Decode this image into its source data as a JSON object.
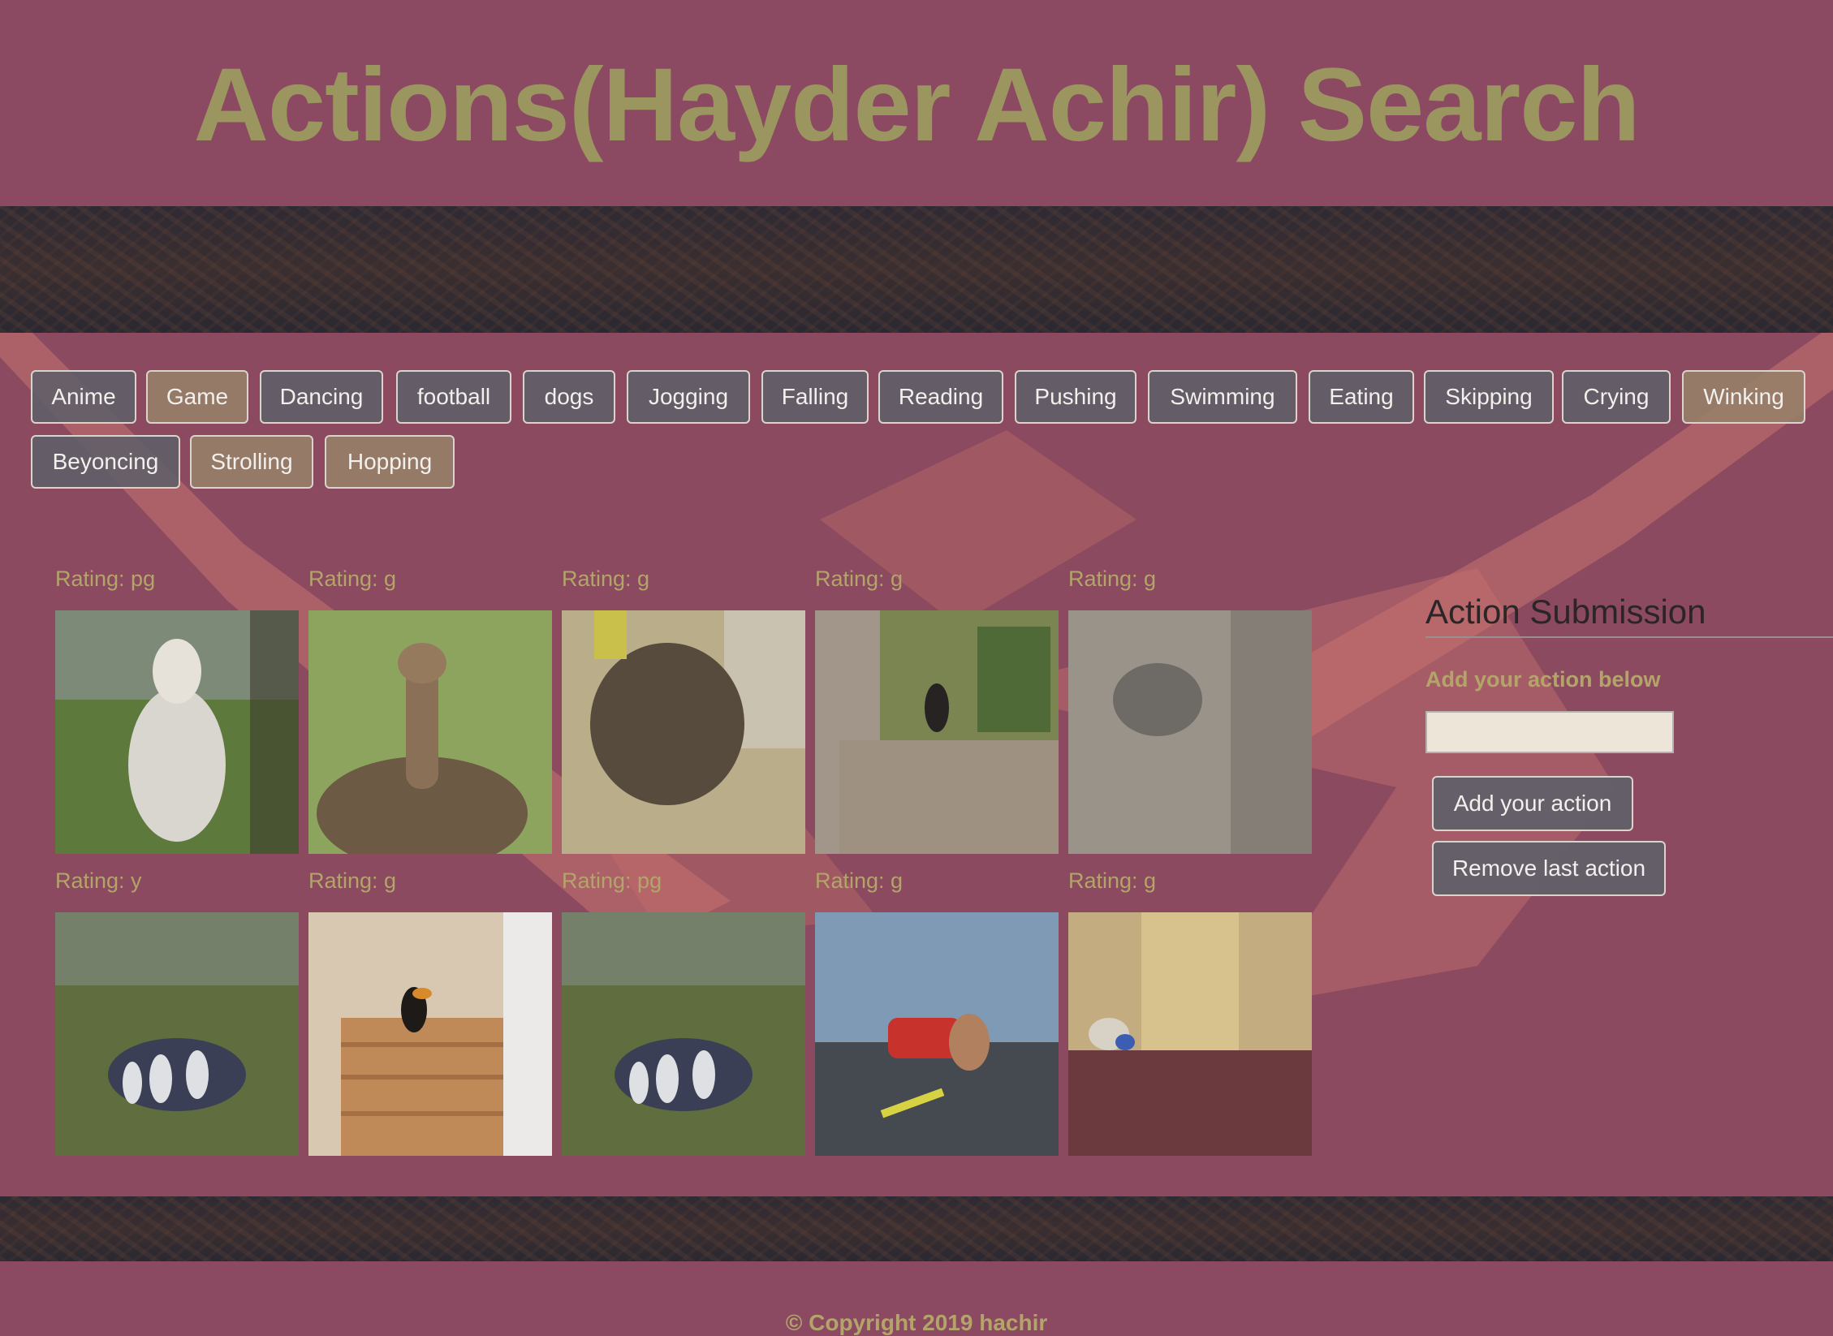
{
  "header": {
    "title": "Actions(Hayder Achir) Search"
  },
  "action_buttons": [
    {
      "label": "Anime",
      "style": "grey"
    },
    {
      "label": "Game",
      "style": "tan"
    },
    {
      "label": "Dancing",
      "style": "grey"
    },
    {
      "label": "football",
      "style": "grey"
    },
    {
      "label": "dogs",
      "style": "grey"
    },
    {
      "label": "Jogging",
      "style": "grey"
    },
    {
      "label": "Falling",
      "style": "grey"
    },
    {
      "label": "Reading",
      "style": "grey"
    },
    {
      "label": "Pushing",
      "style": "grey"
    },
    {
      "label": "Swimming",
      "style": "grey"
    },
    {
      "label": "Eating",
      "style": "grey"
    },
    {
      "label": "Skipping",
      "style": "grey"
    },
    {
      "label": "Crying",
      "style": "grey"
    },
    {
      "label": "Winking",
      "style": "tan"
    },
    {
      "label": "Beyoncing",
      "style": "grey"
    },
    {
      "label": "Strolling",
      "style": "tan"
    },
    {
      "label": "Hopping",
      "style": "tan"
    }
  ],
  "gifs": [
    {
      "rating": "Rating: pg",
      "subject": "white-alpaca"
    },
    {
      "rating": "Rating: g",
      "subject": "brown-alpaca"
    },
    {
      "rating": "Rating: g",
      "subject": "seal"
    },
    {
      "rating": "Rating: g",
      "subject": "dog-porch"
    },
    {
      "rating": "Rating: g",
      "subject": "kitten"
    },
    {
      "rating": "Rating: y",
      "subject": "penguins"
    },
    {
      "rating": "Rating: g",
      "subject": "toucan-stairs"
    },
    {
      "rating": "Rating: pg",
      "subject": "penguins"
    },
    {
      "rating": "Rating: g",
      "subject": "red-car"
    },
    {
      "rating": "Rating: g",
      "subject": "toy-hallway"
    }
  ],
  "sidebar": {
    "title": "Action Submission",
    "label": "Add your action below",
    "input_value": "",
    "add_button": "Add your action",
    "remove_button": "Remove last action"
  },
  "footer": {
    "copyright": "© Copyright 2019 hachir"
  }
}
